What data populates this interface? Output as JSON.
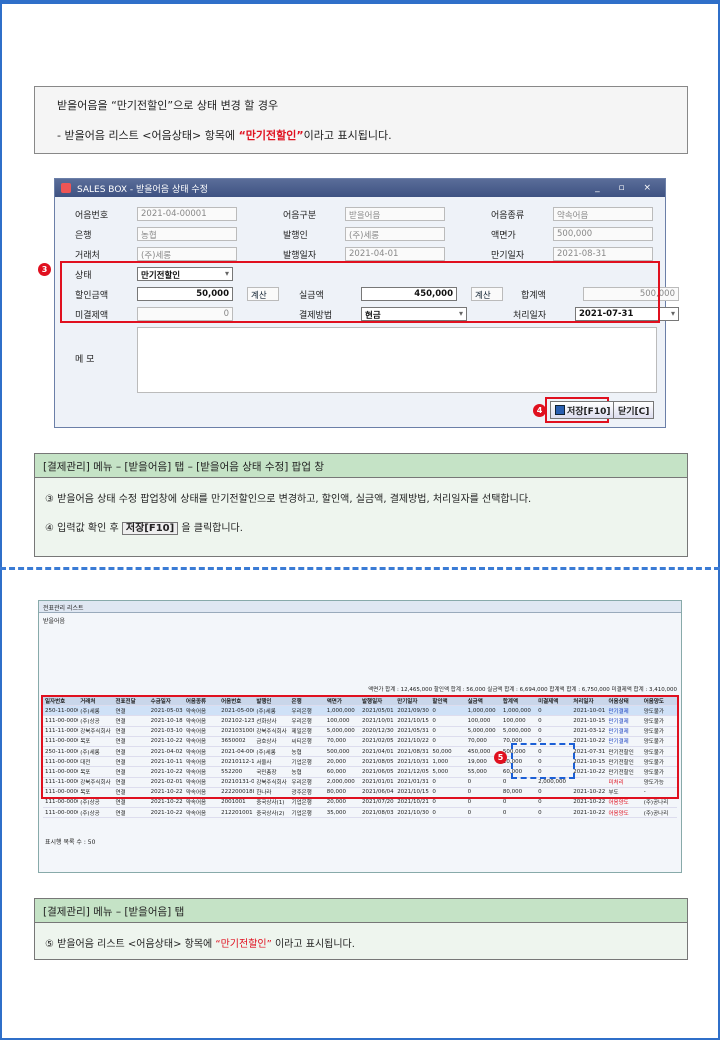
{
  "note": {
    "line1": "받을어음을 “만기전할인”으로 상태 변경 할 경우",
    "line2_pre": "- 받을어음 리스트 <어음상태> 항목에 ",
    "line2_red": "“만기전할인”",
    "line2_post": "이라고 표시됩니다."
  },
  "dialog": {
    "title": "SALES BOX - 받을어음 상태 수정",
    "rows": [
      [
        "어음번호",
        "2021-04-00001",
        "어음구분",
        "받을어음",
        "어음종류",
        "약속어음"
      ],
      [
        "은행",
        "농협",
        "발행인",
        "(주)세롱",
        "액면가",
        "500,000"
      ],
      [
        "거래처",
        "(주)세롱",
        "발행일자",
        "2021-04-01",
        "만기일자",
        "2021-08-31"
      ]
    ],
    "status_label": "상태",
    "status_value": "만기전할인",
    "discount_label": "할인금액",
    "discount_value": "50,000",
    "calc": "계산",
    "actual_label": "실금액",
    "actual_value": "450,000",
    "sum_label": "합계액",
    "sum_value": "500,000",
    "unpaid_label": "미결제액",
    "unpaid_value": "0",
    "pay_label": "결제방법",
    "pay_value": "현금",
    "proc_label": "처리일자",
    "proc_value": "2021-07-31",
    "memo_label": "메 모",
    "save": "저장[F10]",
    "close": "닫기[C]"
  },
  "box1": {
    "head": "[결제관리] 메뉴 – [받을어음] 탭 – [받을어음 상태 수정] 팝업 창",
    "line1": "③  받을어음 상태 수정 팝업창에 상태를 만기전할인으로 변경하고, 할인액, 실금액, 결제방법, 처리일자를 선택합니다.",
    "line2_pre": "④  입력값 확인 후 ",
    "line2_btn": "저장[F10]",
    "line2_post": " 을  클릭합니다."
  },
  "list": {
    "tab": "전표관리 리스트",
    "sub": "받을어음",
    "headers": [
      "일자번호",
      "거래처",
      "전표전달",
      "수금일자",
      "어음종류",
      "어음번호",
      "발행인",
      "은행",
      "액면가",
      "발행일자",
      "만기일자",
      "할인액",
      "실금액",
      "합계액",
      "미결제액",
      "처리일자",
      "어음상태",
      "어음양도"
    ],
    "rows": [
      [
        "250-11-00001",
        "(주)세롱",
        "연결",
        "2021-05-03",
        "약속어음",
        "2021-05-0001",
        "(주)세롱",
        "우리은행",
        "1,000,000",
        "2021/05/01",
        "2021/09/30",
        "0",
        "1,000,000",
        "1,000,000",
        "0",
        "2021-10-01",
        "만기결제",
        "양도불가"
      ],
      [
        "111-00-00005",
        "(주)상공",
        "연결",
        "2021-10-18",
        "약속어음",
        "202102-123400",
        "선화상사",
        "우리은행",
        "100,000",
        "2021/10/01",
        "2021/10/15",
        "0",
        "100,000",
        "100,000",
        "0",
        "2021-10-15",
        "만기결제",
        "양도불가"
      ],
      [
        "111-11-00002",
        "강북주식회사",
        "연결",
        "2021-03-10",
        "약속어음",
        "202103100012",
        "강북주식회사",
        "제일은행",
        "5,000,000",
        "2020/12/30",
        "2021/05/31",
        "0",
        "5,000,000",
        "5,000,000",
        "0",
        "2021-03-12",
        "만기결제",
        "양도불가"
      ],
      [
        "111-00-00009",
        "목포",
        "연결",
        "2021-10-22",
        "약속어음",
        "3650002",
        "금호상사",
        "씨티은행",
        "70,000",
        "2021/02/05",
        "2021/10/22",
        "0",
        "70,000",
        "70,000",
        "0",
        "2021-10-22",
        "만기결제",
        "양도불가"
      ],
      [
        "250-11-00001",
        "(주)세롱",
        "연결",
        "2021-04-02",
        "약속어음",
        "2021-04-00001",
        "(주)세롱",
        "농협",
        "500,000",
        "2021/04/01",
        "2021/08/31",
        "50,000",
        "450,000",
        "500,000",
        "0",
        "2021-07-31",
        "만기전할인",
        "양도불가"
      ],
      [
        "111-00-00007",
        "대전",
        "연결",
        "2021-10-11",
        "약속어음",
        "20210112-1112",
        "서울사",
        "기업은행",
        "20,000",
        "2021/08/05",
        "2021/10/31",
        "1,000",
        "19,000",
        "20,000",
        "0",
        "2021-10-15",
        "만기전할인",
        "양도불가"
      ],
      [
        "111-00-00006",
        "목포",
        "연결",
        "2021-10-22",
        "약속어음",
        "552200",
        "국민총장",
        "농협",
        "60,000",
        "2021/06/05",
        "2021/12/05",
        "5,000",
        "55,000",
        "60,000",
        "0",
        "2021-10-22",
        "만기전할인",
        "양도불가"
      ],
      [
        "111-11-00002",
        "강북주식회사",
        "연결",
        "2021-02-01",
        "약속어음",
        "20210131-0001",
        "강북주식회사",
        "우리은행",
        "2,000,000",
        "2021/01/01",
        "2021/01/31",
        "0",
        "0",
        "0",
        "2,000,000",
        "",
        "미처리",
        "양도가능"
      ],
      [
        "111-00-00006",
        "목포",
        "연결",
        "2021-10-22",
        "약속어음",
        "2222000188",
        "한나라",
        "광주은행",
        "80,000",
        "2021/06/04",
        "2021/10/15",
        "0",
        "0",
        "80,000",
        "0",
        "2021-10-22",
        "부도",
        "-"
      ],
      [
        "111-00-00005",
        "(주)상공",
        "연결",
        "2021-10-22",
        "약속어음",
        "2001001",
        "중국상사(1)",
        "기업은행",
        "20,000",
        "2021/07/20",
        "2021/10/21",
        "0",
        "0",
        "0",
        "0",
        "2021-10-22",
        "어음양도",
        "(주)공나리"
      ],
      [
        "111-00-00005",
        "(주)상공",
        "연결",
        "2021-10-22",
        "약속어음",
        "212201001",
        "중국상사(2)",
        "기업은행",
        "35,000",
        "2021/08/03",
        "2021/10/30",
        "0",
        "0",
        "0",
        "0",
        "2021-10-22",
        "어음양도",
        "(주)공나리"
      ]
    ],
    "totals": "액면가 합계 : 12,465,000   할인액 합계 : 56,000   실금액 합계 : 6,694,000   합계액 합계 : 6,750,000   미결제액 합계 : 3,410,000",
    "footer": "표시행 목록 수 : 50"
  },
  "box2": {
    "head": "[결제관리] 메뉴 – [받을어음] 탭",
    "line_pre": "⑤  받을어음 리스트 <어음상태> 항목에 ",
    "line_red": "“만기전할인”",
    "line_post": " 이라고 표시됩니다."
  }
}
